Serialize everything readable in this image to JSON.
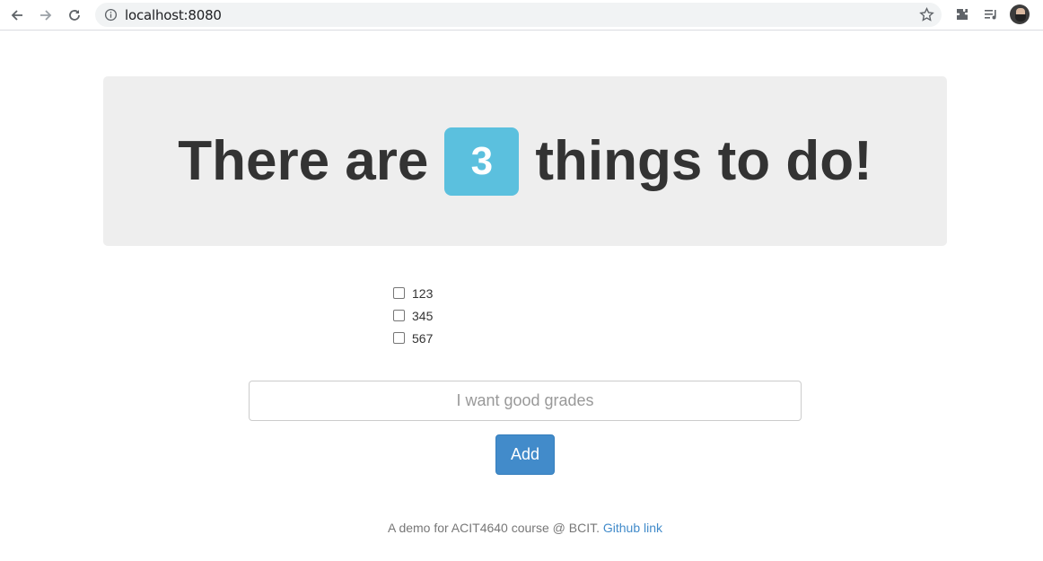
{
  "browser": {
    "url": "localhost:8080",
    "icons": [
      "back-arrow-icon",
      "forward-arrow-icon",
      "reload-icon",
      "info-icon",
      "star-icon",
      "extensions-icon",
      "media-control-icon",
      "profile-avatar"
    ]
  },
  "header": {
    "prefix": "There are",
    "count": "3",
    "suffix": "things to do!"
  },
  "todos": [
    {
      "label": "123",
      "checked": false
    },
    {
      "label": "345",
      "checked": false
    },
    {
      "label": "567",
      "checked": false
    }
  ],
  "form": {
    "input_placeholder": "I want good grades",
    "input_value": "",
    "add_label": "Add"
  },
  "footer": {
    "text": "A demo for ACIT4640 course @ BCIT.",
    "link_text": "Github link"
  },
  "colors": {
    "badge": "#5bc0de",
    "button": "#428bca",
    "jumbotron": "#eeeeee",
    "link": "#428bca"
  }
}
